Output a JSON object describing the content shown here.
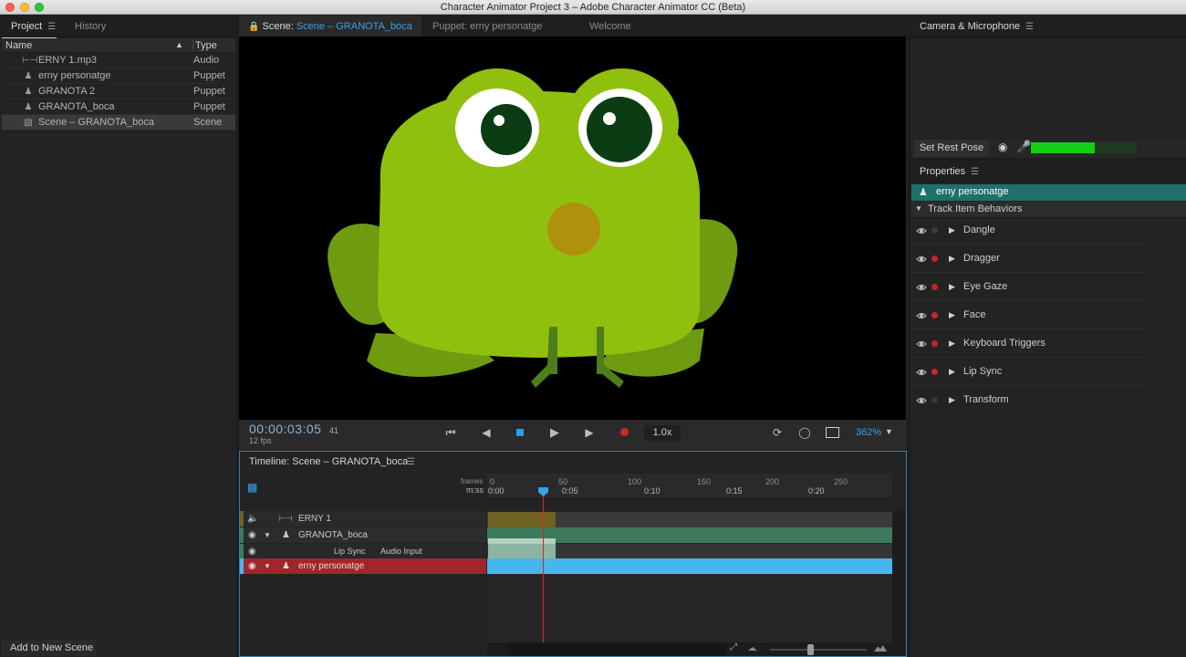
{
  "window": {
    "title": "Character Animator Project 3 – Adobe Character Animator CC (Beta)"
  },
  "colors": {
    "accent": "#2b8fd6",
    "selection_teal": "#1f6f6b",
    "record_red": "#c0282b",
    "track_blue": "#46b7ec",
    "audio_olive": "#6f6221",
    "puppet_green": "#3c7a5b",
    "mic_green": "#14d014"
  },
  "project": {
    "tabs": [
      "Project",
      "History"
    ],
    "columns": {
      "name": "Name",
      "type": "Type"
    },
    "items": [
      {
        "icon": "audio-icon",
        "name": "ERNY  1.mp3",
        "type": "Audio"
      },
      {
        "icon": "puppet-icon",
        "name": "erny personatge",
        "type": "Puppet"
      },
      {
        "icon": "puppet-icon",
        "name": "GRANOTA 2",
        "type": "Puppet"
      },
      {
        "icon": "puppet-icon",
        "name": "GRANOTA_boca",
        "type": "Puppet"
      },
      {
        "icon": "scene-icon",
        "name": "Scene – GRANOTA_boca",
        "type": "Scene"
      }
    ],
    "add_button": "Add to New Scene"
  },
  "scene": {
    "tab_prefix": "Scene:",
    "tab_scene": "Scene – GRANOTA_boca",
    "tab_puppet": "Puppet: erny personatge",
    "tab_welcome": "Welcome",
    "timecode": "00:00:03:05",
    "frame": "41",
    "fps": "12 fps",
    "speed": "1.0x",
    "zoom": "362%"
  },
  "timeline": {
    "title": "Timeline: Scene – GRANOTA_boca",
    "ruler_labels": {
      "frames": "frames",
      "mss": "m:ss"
    },
    "frame_ticks": [
      "0",
      "50",
      "100",
      "150",
      "200",
      "250"
    ],
    "time_ticks": [
      "0:00",
      "0:05",
      "0:10",
      "0:15",
      "0:20"
    ],
    "tracks": [
      {
        "name": "ERNY  1"
      },
      {
        "name": "GRANOTA_boca"
      },
      {
        "behavior": "Lip Sync",
        "param": "Audio Input"
      },
      {
        "name": "erny personatge"
      }
    ]
  },
  "camera": {
    "title": "Camera & Microphone",
    "rest_pose": "Set Rest Pose",
    "mic_level": 0.6
  },
  "properties": {
    "title": "Properties",
    "selected_puppet": "erny personatge",
    "section": "Track Item Behaviors",
    "behaviors": [
      {
        "name": "Dangle",
        "armed": false
      },
      {
        "name": "Dragger",
        "armed": true
      },
      {
        "name": "Eye Gaze",
        "armed": true
      },
      {
        "name": "Face",
        "armed": true
      },
      {
        "name": "Keyboard Triggers",
        "armed": true
      },
      {
        "name": "Lip Sync",
        "armed": true
      },
      {
        "name": "Transform",
        "armed": false
      }
    ]
  }
}
